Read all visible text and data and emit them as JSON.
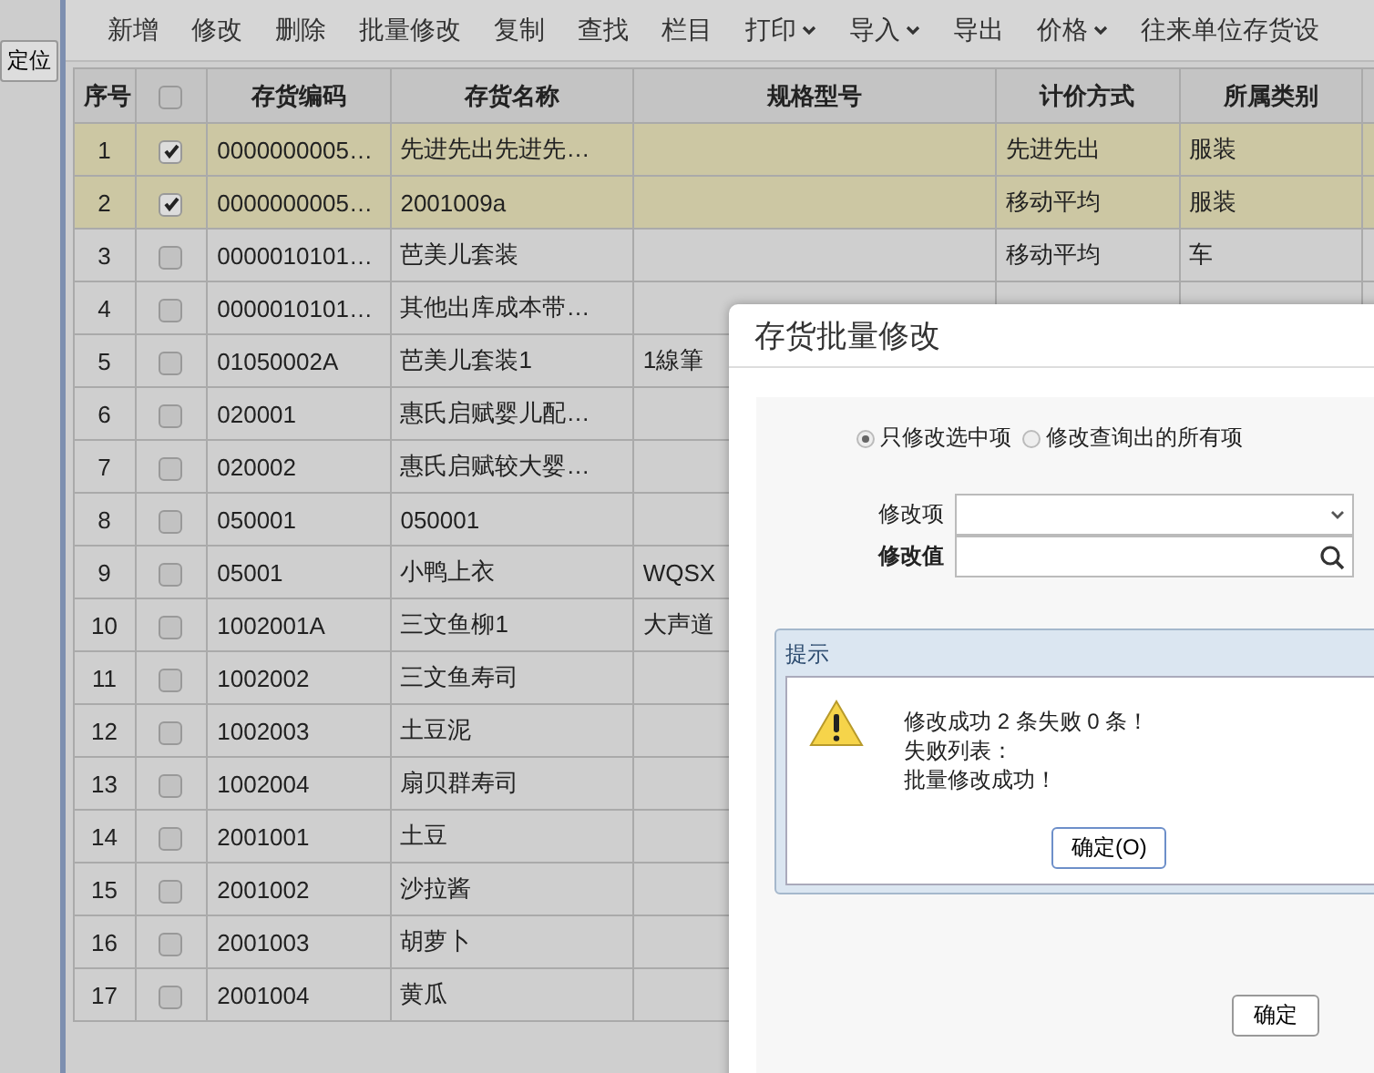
{
  "side_panel": {
    "locate_button": "定位"
  },
  "toolbar": [
    {
      "label": "新增",
      "dropdown": false
    },
    {
      "label": "修改",
      "dropdown": false
    },
    {
      "label": "删除",
      "dropdown": false
    },
    {
      "label": "批量修改",
      "dropdown": false
    },
    {
      "label": "复制",
      "dropdown": false
    },
    {
      "label": "查找",
      "dropdown": false
    },
    {
      "label": "栏目",
      "dropdown": false
    },
    {
      "label": "打印",
      "dropdown": true
    },
    {
      "label": "导入",
      "dropdown": true
    },
    {
      "label": "导出",
      "dropdown": false
    },
    {
      "label": "价格",
      "dropdown": true
    },
    {
      "label": "往来单位存货设",
      "dropdown": false
    }
  ],
  "table": {
    "select_all_checked": false,
    "columns": [
      "序号",
      "存货编码",
      "存货名称",
      "规格型号",
      "计价方式",
      "所属类别"
    ],
    "rows": [
      {
        "no": "1",
        "selected": true,
        "code": "0000000005…",
        "name": "先进先出先进先…",
        "spec": "",
        "pricing": "先进先出",
        "category": "服装"
      },
      {
        "no": "2",
        "selected": true,
        "code": "0000000005…",
        "name": "2001009a",
        "spec": "",
        "pricing": "移动平均",
        "category": "服装"
      },
      {
        "no": "3",
        "selected": false,
        "code": "0000010101…",
        "name": "芭美儿套装",
        "spec": "",
        "pricing": "移动平均",
        "category": "车"
      },
      {
        "no": "4",
        "selected": false,
        "code": "0000010101…",
        "name": "其他出库成本带…",
        "spec": ""
      },
      {
        "no": "5",
        "selected": false,
        "code": "01050002A",
        "name": "芭美儿套装1",
        "spec": "1線筆"
      },
      {
        "no": "6",
        "selected": false,
        "code": "020001",
        "name": "惠氏启赋婴儿配…",
        "spec": ""
      },
      {
        "no": "7",
        "selected": false,
        "code": "020002",
        "name": "惠氏启赋较大婴…",
        "spec": ""
      },
      {
        "no": "8",
        "selected": false,
        "code": "050001",
        "name": "050001",
        "spec": ""
      },
      {
        "no": "9",
        "selected": false,
        "code": "05001",
        "name": "小鸭上衣",
        "spec": "WQSX"
      },
      {
        "no": "10",
        "selected": false,
        "code": "1002001A",
        "name": "三文鱼柳1",
        "spec": "大声道"
      },
      {
        "no": "11",
        "selected": false,
        "code": "1002002",
        "name": "三文鱼寿司",
        "spec": ""
      },
      {
        "no": "12",
        "selected": false,
        "code": "1002003",
        "name": "土豆泥",
        "spec": ""
      },
      {
        "no": "13",
        "selected": false,
        "code": "1002004",
        "name": "扇贝群寿司",
        "spec": ""
      },
      {
        "no": "14",
        "selected": false,
        "code": "2001001",
        "name": "土豆",
        "spec": ""
      },
      {
        "no": "15",
        "selected": false,
        "code": "2001002",
        "name": "沙拉酱",
        "spec": ""
      },
      {
        "no": "16",
        "selected": false,
        "code": "2001003",
        "name": "胡萝卜",
        "spec": ""
      },
      {
        "no": "17",
        "selected": false,
        "code": "2001004",
        "name": "黄瓜",
        "spec": ""
      }
    ]
  },
  "dialog": {
    "title": "存货批量修改",
    "scope_options": [
      {
        "label": "只修改选中项",
        "selected": true
      },
      {
        "label": "修改查询出的所有项",
        "selected": false
      }
    ],
    "field_item_label": "修改项",
    "field_value_label": "修改值",
    "message_box": {
      "title": "提示",
      "lines": [
        "修改成功 2 条失败 0 条！",
        "失败列表：",
        "批量修改成功！"
      ],
      "button": "确定(O)"
    },
    "buttons": [
      "确定"
    ]
  }
}
